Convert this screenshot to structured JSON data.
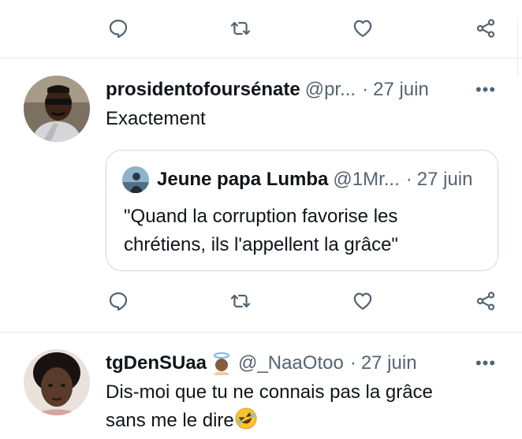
{
  "tweets": [
    {
      "name": "prosidentofoursénate",
      "handle": "@pr...",
      "dot": "·",
      "time": "27 juin",
      "more_label": "•••",
      "text": "Exactement",
      "quote": {
        "name": "Jeune papa Lumba",
        "handle": "@1Mr...",
        "dot": "·",
        "time": "27 juin",
        "line1": "\"Quand la corruption favorise les",
        "line2": "chrétiens, ils l'appellent la grâce\""
      }
    },
    {
      "name": "tgDenSUaa",
      "name_emoji": "angel-emoji",
      "handle": "@_NaaOtoo",
      "dot": "·",
      "time": "27 juin",
      "more_label": "•••",
      "line1": "Dis-moi que tu ne connais pas la grâce",
      "line2": "sans me le dire",
      "trailing_emoji": "rolling-laughing-emoji"
    }
  ],
  "actions": [
    "reply-icon",
    "retweet-icon",
    "like-icon",
    "share-icon"
  ],
  "colors": {
    "text": "#0f1419",
    "secondary": "#536471",
    "border": "#cfd9de",
    "divider": "#e6ecf0"
  }
}
